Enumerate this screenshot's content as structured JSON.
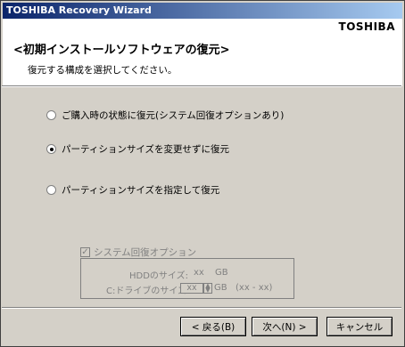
{
  "window": {
    "title": "TOSHIBA Recovery Wizard"
  },
  "header": {
    "brand": "TOSHIBA",
    "page_title": "<初期インストールソフトウェアの復元>",
    "subtitle": "復元する構成を選択してください。"
  },
  "options": [
    {
      "label": "ご購入時の状態に復元(システム回復オプションあり)",
      "selected": false
    },
    {
      "label": "パーティションサイズを変更せずに復元",
      "selected": true
    },
    {
      "label": "パーティションサイズを指定して復元",
      "selected": false
    }
  ],
  "system_recovery_group": {
    "checkbox_label": "システム回復オプション",
    "checked": true,
    "hdd_size_label": "HDDのサイズ:",
    "hdd_size_value": "xx",
    "hdd_size_unit": "GB",
    "c_drive_label": "C:ドライブのサイズ:",
    "c_drive_value": "xx",
    "c_drive_unit": "GB",
    "c_drive_range": "(xx - xx)"
  },
  "buttons": {
    "back": "< 戻る(B)",
    "next": "次へ(N) >",
    "cancel": "キャンセル"
  }
}
